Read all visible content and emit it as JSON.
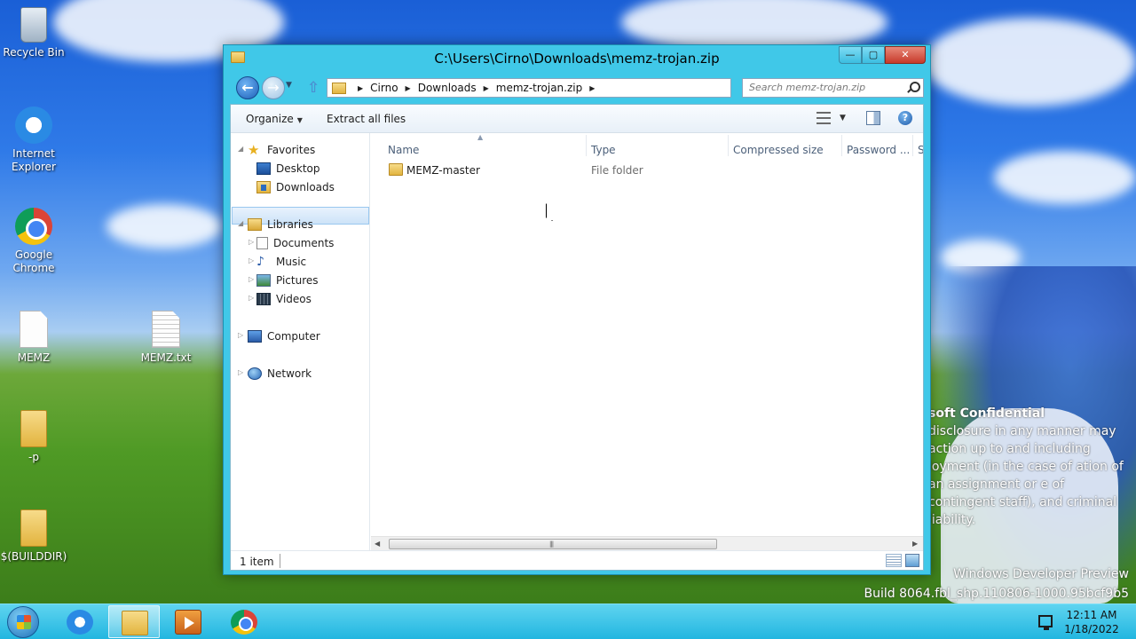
{
  "desktop": {
    "icons": [
      {
        "label": "Recycle Bin",
        "icon": "recycle-bin-icon"
      },
      {
        "label": "Internet Explorer",
        "icon": "internet-explorer-icon"
      },
      {
        "label": "Google Chrome",
        "icon": "google-chrome-icon"
      },
      {
        "label": "MEMZ",
        "icon": "file-icon"
      },
      {
        "label": "MEMZ.txt",
        "icon": "text-file-icon"
      },
      {
        "label": "-p",
        "icon": "folder-icon"
      },
      {
        "label": "$(BUILDDIR)",
        "icon": "folder-icon"
      }
    ],
    "watermark": {
      "title": "soft Confidential",
      "body": "disclosure in any manner may action up to and including loyment (in the case of ation of an assignment or e of contingent staff), and criminal liability."
    },
    "build_line1": "Windows Developer Preview",
    "build_line2": "Build 8064.fbl_shp.110806-1000.95bcf9b5"
  },
  "window": {
    "title": "C:\\Users\\Cirno\\Downloads\\memz-trojan.zip",
    "controls": {
      "minimize": "—",
      "maximize": "▢",
      "close": "✕"
    },
    "address": {
      "crumbs": [
        "Cirno",
        "Downloads",
        "memz-trojan.zip"
      ]
    },
    "search": {
      "placeholder": "Search memz-trojan.zip"
    },
    "toolbar": {
      "organize": "Organize",
      "extract_all": "Extract all files"
    },
    "nav": {
      "favorites": "Favorites",
      "desktop": "Desktop",
      "downloads": "Downloads",
      "libraries": "Libraries",
      "documents": "Documents",
      "music": "Music",
      "pictures": "Pictures",
      "videos": "Videos",
      "computer": "Computer",
      "network": "Network"
    },
    "columns": {
      "name": "Name",
      "type": "Type",
      "compressed_size": "Compressed size",
      "password": "Password ...",
      "size": "Si"
    },
    "files": [
      {
        "name": "MEMZ-master",
        "type": "File folder"
      }
    ],
    "status": {
      "items": "1 item"
    }
  },
  "taskbar": {
    "apps": [
      "start-button",
      "internet-explorer",
      "file-explorer",
      "media-player",
      "google-chrome"
    ],
    "clock": {
      "time": "12:11 AM",
      "date": "1/18/2022"
    }
  }
}
